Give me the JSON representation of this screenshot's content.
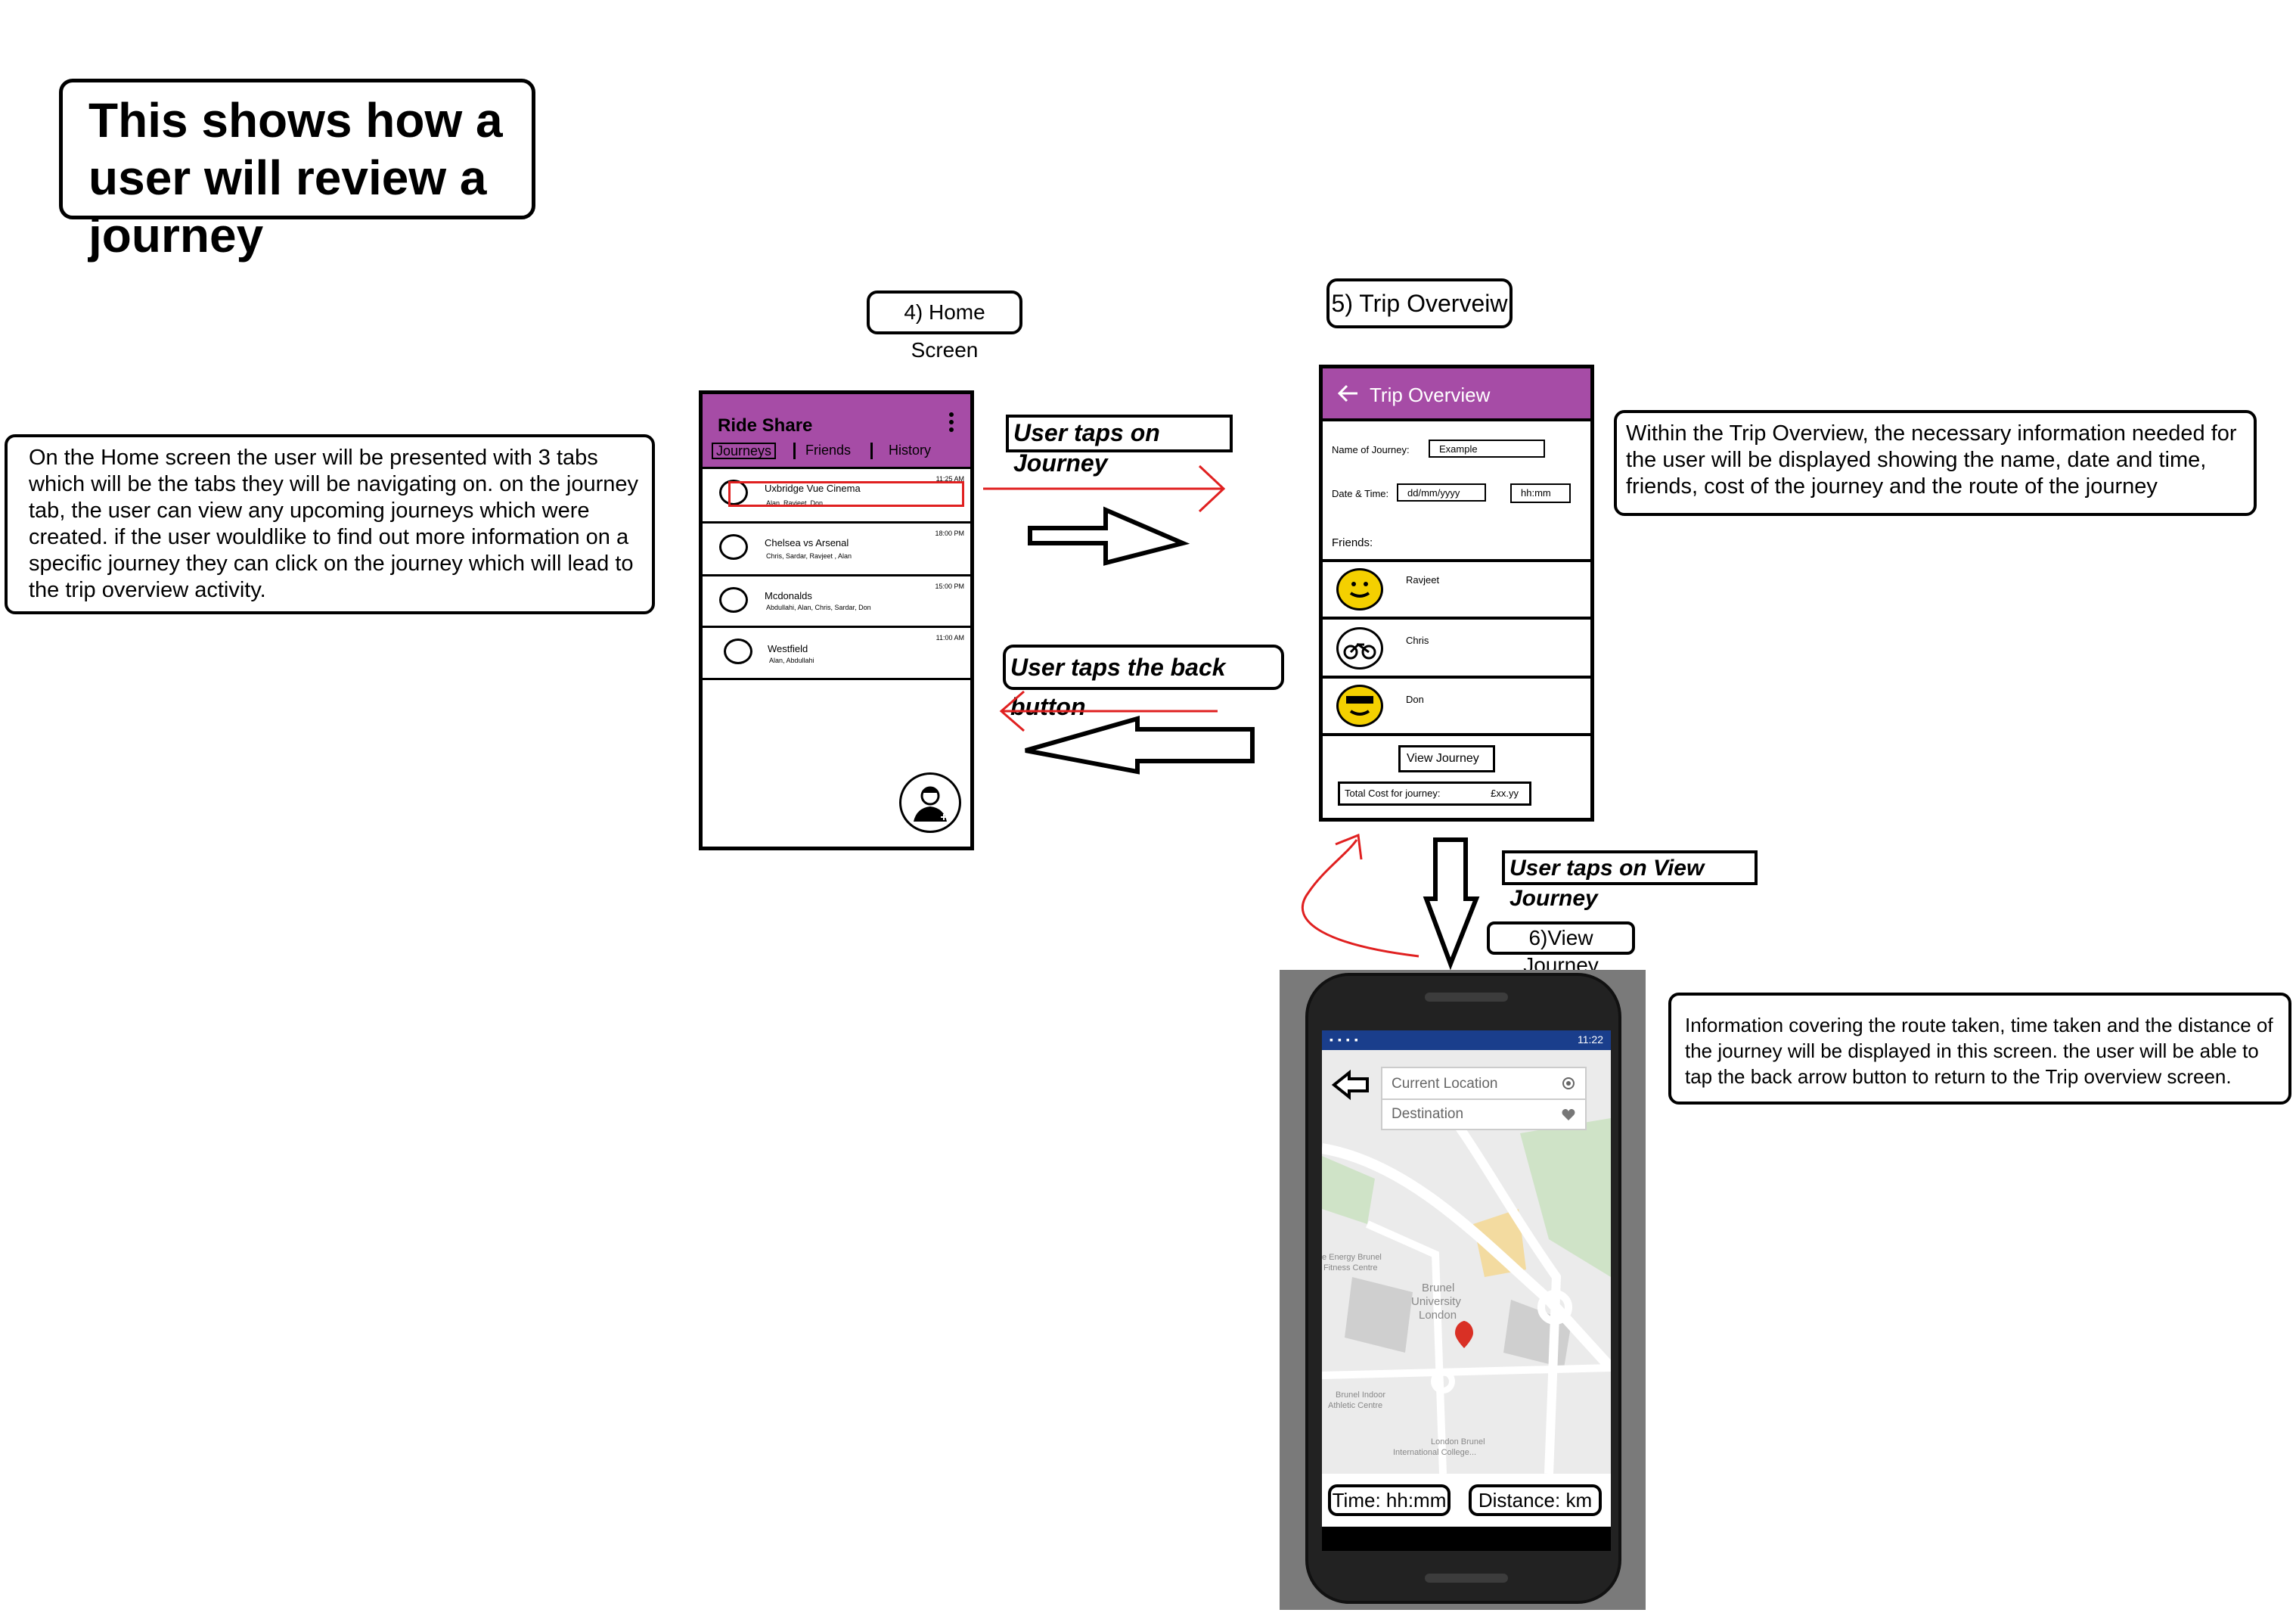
{
  "title": "This shows how a user will review a journey",
  "home_desc": "On the Home screen the user will be presented with 3 tabs which will be the tabs they will be navigating on. on the journey tab, the user can view any upcoming journeys which were created. if the user wouldlike to find out more information on a specific journey they can click on the journey which will lead to the trip overview activity.",
  "trip_desc": "Within the Trip Overview, the necessary information needed for the user will be displayed showing the name, date and time, friends, cost of the journey and the route of the journey",
  "view_desc": "Information covering the route taken, time taken and the distance of the journey will be displayed in this screen. the user will be able to tap the back arrow button to return to the Trip overview screen.",
  "labels": {
    "home": "4) Home Screen",
    "trip": "5) Trip Overveiw",
    "view": "6)View Journey",
    "tap_journey": "User taps on Journey",
    "tap_back": "User taps the back button",
    "tap_view": "User taps on View Journey"
  },
  "home": {
    "app_title": "Ride Share",
    "tabs": [
      "Journeys",
      "Friends",
      "History"
    ],
    "journeys": [
      {
        "title": "Uxbridge Vue Cinema",
        "people": "Alan, Ravjeet, Don",
        "time": "11:25 AM"
      },
      {
        "title": "Chelsea vs Arsenal",
        "people": "Chris, Sardar, Ravjeet , Alan",
        "time": "18:00 PM"
      },
      {
        "title": "Mcdonalds",
        "people": "Abdullahi, Alan, Chris, Sardar, Don",
        "time": "15:00 PM"
      },
      {
        "title": "Westfield",
        "people": "Alan, Abdullahi",
        "time": "11:00 AM"
      }
    ]
  },
  "trip": {
    "header": "Trip Overview",
    "name_label": "Name of Journey:",
    "name_value": "Example",
    "date_label": "Date & Time:",
    "date_value": "dd/mm/yyyy",
    "time_value": "hh:mm",
    "friends_label": "Friends:",
    "friends": [
      "Ravjeet",
      "Chris",
      "Don"
    ],
    "view_button": "View Journey",
    "cost_label": "Total Cost for journey:",
    "cost_value": "£xx.yy"
  },
  "view": {
    "status_time": "11:22",
    "current_location": "Current Location",
    "destination": "Destination",
    "map_labels": [
      "e Energy Brunel",
      "Fitness Centre",
      "Brunel",
      "University",
      "London",
      "Brunel Indoor",
      "Athletic Centre",
      "London Brunel",
      "International College..."
    ],
    "time": "Time: hh:mm",
    "distance": "Distance: km"
  }
}
